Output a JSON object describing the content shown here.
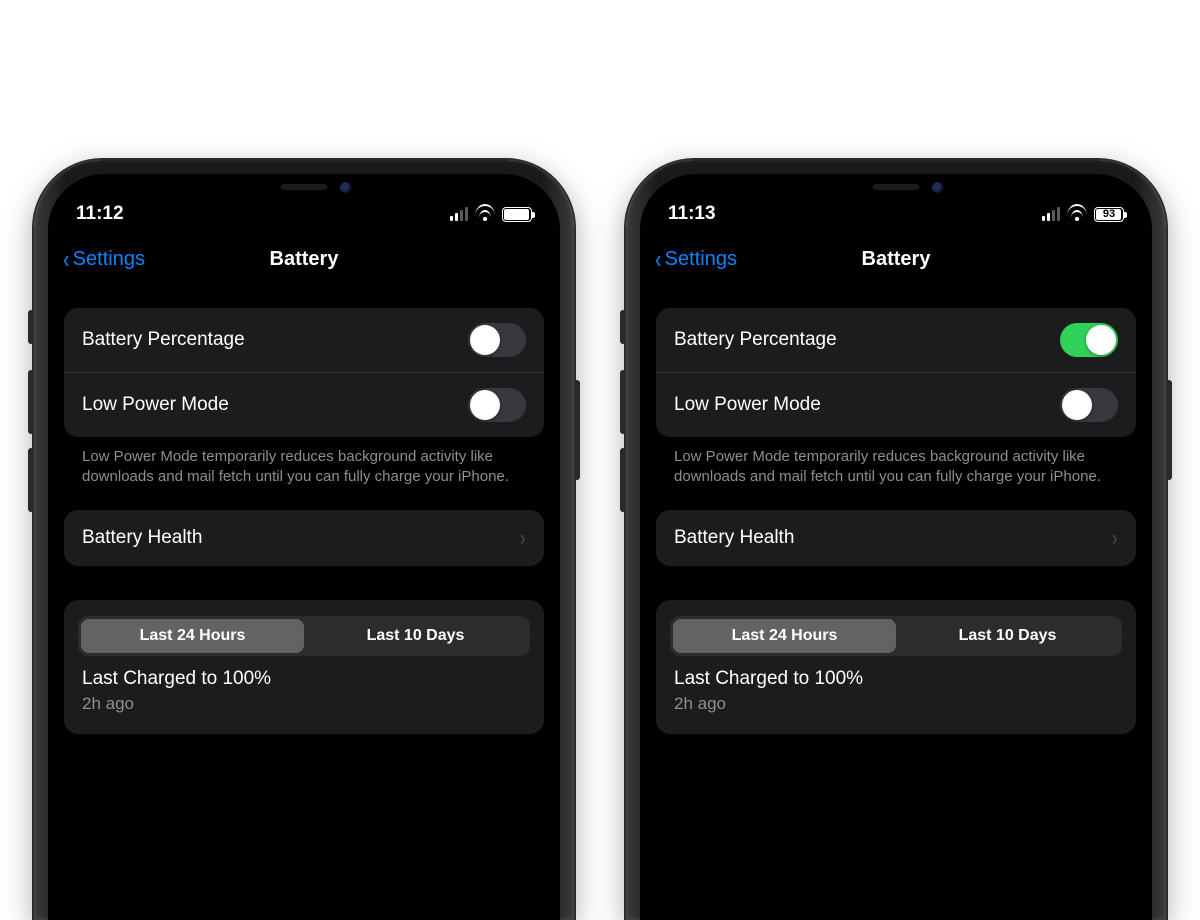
{
  "colors": {
    "accent_blue": "#0a84ff",
    "toggle_on": "#30d158"
  },
  "phones": [
    {
      "id": "left",
      "status": {
        "time": "11:12",
        "signal_bars_on": 2,
        "battery_show_pct": false,
        "battery_pct": "93",
        "battery_fill_pct": 93
      },
      "nav": {
        "back_label": "Settings",
        "title": "Battery"
      },
      "rows": {
        "battery_percentage": {
          "label": "Battery Percentage",
          "on": false
        },
        "low_power_mode": {
          "label": "Low Power Mode",
          "on": false
        }
      },
      "footer": "Low Power Mode temporarily reduces background activity like downloads and mail fetch until you can fully charge your iPhone.",
      "battery_health_label": "Battery Health",
      "segmented": {
        "options": [
          "Last 24 Hours",
          "Last 10 Days"
        ],
        "active": 0
      },
      "last_charged": {
        "title": "Last Charged to 100%",
        "sub": "2h ago"
      }
    },
    {
      "id": "right",
      "status": {
        "time": "11:13",
        "signal_bars_on": 2,
        "battery_show_pct": true,
        "battery_pct": "93",
        "battery_fill_pct": 93
      },
      "nav": {
        "back_label": "Settings",
        "title": "Battery"
      },
      "rows": {
        "battery_percentage": {
          "label": "Battery Percentage",
          "on": true
        },
        "low_power_mode": {
          "label": "Low Power Mode",
          "on": false
        }
      },
      "footer": "Low Power Mode temporarily reduces background activity like downloads and mail fetch until you can fully charge your iPhone.",
      "battery_health_label": "Battery Health",
      "segmented": {
        "options": [
          "Last 24 Hours",
          "Last 10 Days"
        ],
        "active": 0
      },
      "last_charged": {
        "title": "Last Charged to 100%",
        "sub": "2h ago"
      }
    }
  ]
}
